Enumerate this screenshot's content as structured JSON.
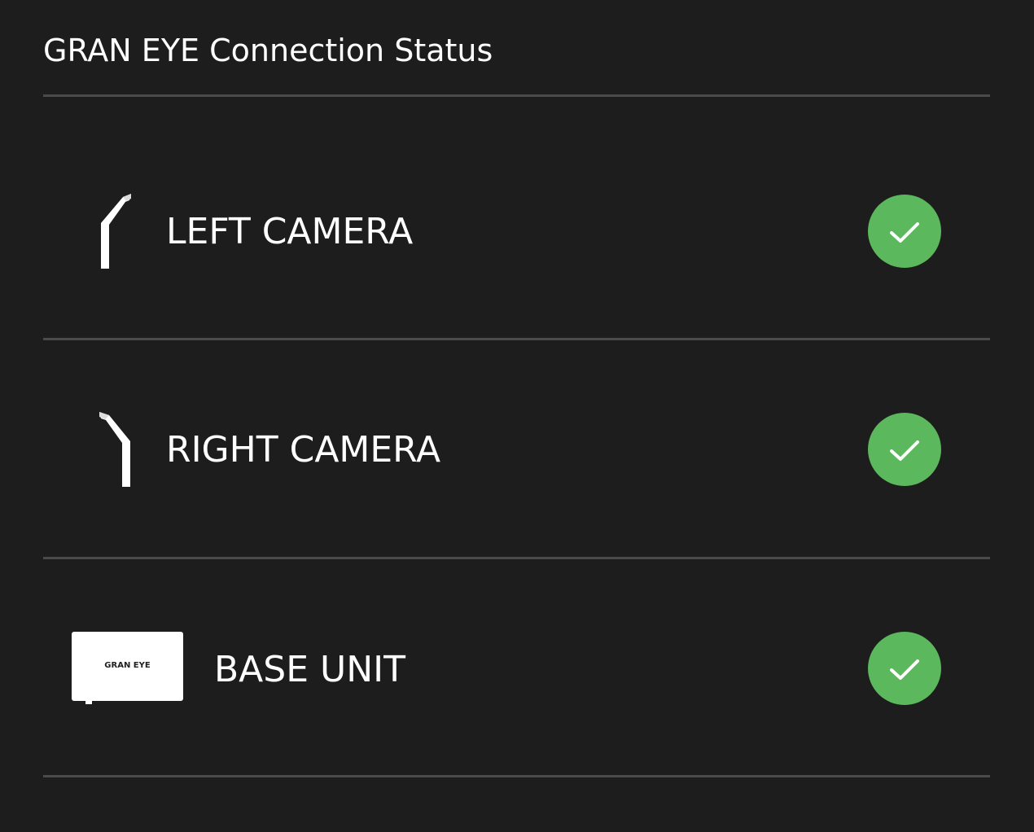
{
  "header": {
    "title": "GRAN EYE Connection Status"
  },
  "colors": {
    "background": "#1d1d1d",
    "divider": "#4a4a4a",
    "status_ok": "#5cb85c"
  },
  "devices": [
    {
      "label": "LEFT CAMERA",
      "icon": "left-camera-arm-icon",
      "status": "connected",
      "status_icon": "check-icon"
    },
    {
      "label": "RIGHT CAMERA",
      "icon": "right-camera-arm-icon",
      "status": "connected",
      "status_icon": "check-icon"
    },
    {
      "label": "BASE UNIT",
      "icon": "base-unit-icon",
      "logo_text": "GRAN EYE",
      "status": "connected",
      "status_icon": "check-icon"
    }
  ]
}
